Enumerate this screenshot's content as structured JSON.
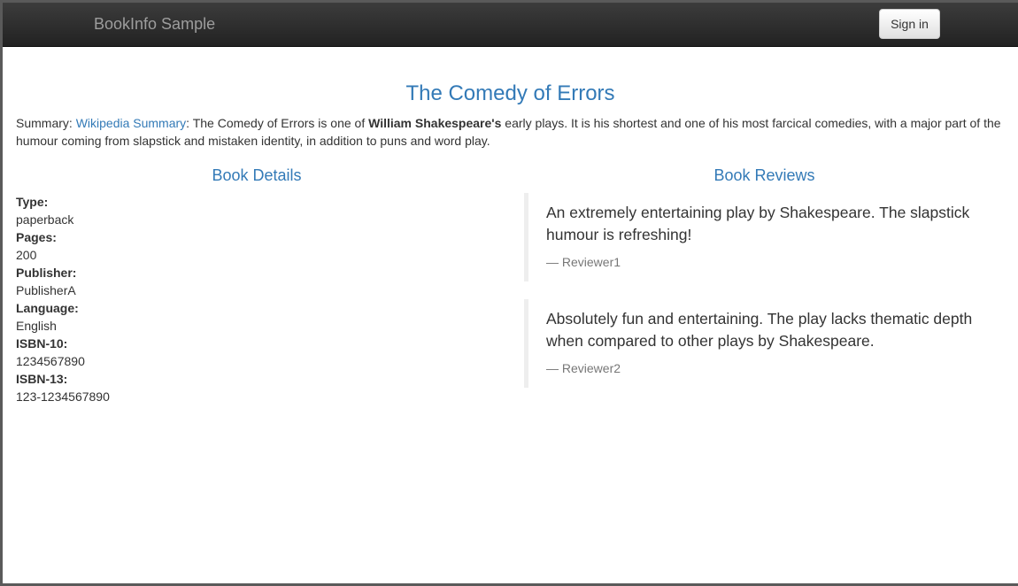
{
  "navbar": {
    "brand": "BookInfo Sample",
    "signin_label": "Sign in"
  },
  "book": {
    "title": "The Comedy of Errors",
    "summary_label": "Summary: ",
    "summary_link": "Wikipedia Summary",
    "summary_part1": ": The Comedy of Errors is one of ",
    "summary_bold": "William Shakespeare's",
    "summary_part2": " early plays. It is his shortest and one of his most farcical comedies, with a major part of the humour coming from slapstick and mistaken identity, in addition to puns and word play."
  },
  "details": {
    "heading": "Book Details",
    "fields": [
      {
        "label": "Type:",
        "value": "paperback"
      },
      {
        "label": "Pages:",
        "value": "200"
      },
      {
        "label": "Publisher:",
        "value": "PublisherA"
      },
      {
        "label": "Language:",
        "value": "English"
      },
      {
        "label": "ISBN-10:",
        "value": "1234567890"
      },
      {
        "label": "ISBN-13:",
        "value": "123-1234567890"
      }
    ]
  },
  "reviews": {
    "heading": "Book Reviews",
    "items": [
      {
        "text": "An extremely entertaining play by Shakespeare. The slapstick humour is refreshing!",
        "reviewer": "— Reviewer1"
      },
      {
        "text": "Absolutely fun and entertaining. The play lacks thematic depth when compared to other plays by Shakespeare.",
        "reviewer": "— Reviewer2"
      }
    ]
  },
  "colors": {
    "accent": "#337ab7",
    "navbar_bg": "#222222",
    "brand_text": "#9d9d9d",
    "reviewer_text": "#777777"
  }
}
